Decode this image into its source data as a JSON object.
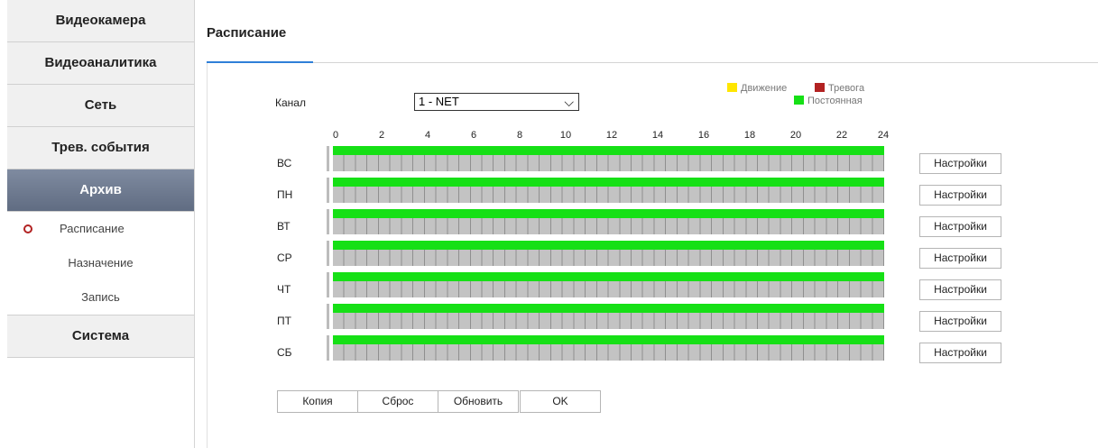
{
  "sidebar": {
    "items_top": [
      {
        "label": "Видеокамера"
      },
      {
        "label": "Видеоаналитика"
      },
      {
        "label": "Сеть"
      },
      {
        "label": "Трев. события"
      },
      {
        "label": "Архив"
      }
    ],
    "subitems": [
      {
        "label": "Расписание"
      },
      {
        "label": "Назначение"
      },
      {
        "label": "Запись"
      }
    ],
    "items_bottom": [
      {
        "label": "Система"
      }
    ]
  },
  "page": {
    "title": "Расписание"
  },
  "channel": {
    "label": "Канал",
    "value": "1 - NET"
  },
  "legend": {
    "motion": {
      "label": "Движение",
      "color": "#ffe600"
    },
    "alarm": {
      "label": "Тревога",
      "color": "#b22222"
    },
    "continuous": {
      "label": "Постоянная",
      "color": "#16e016"
    }
  },
  "hours": [
    "0",
    "2",
    "4",
    "6",
    "8",
    "10",
    "12",
    "14",
    "16",
    "18",
    "20",
    "22",
    "24"
  ],
  "days": [
    {
      "label": "ВС",
      "settings": "Настройки",
      "schedule": "Постоянная 0–24"
    },
    {
      "label": "ПН",
      "settings": "Настройки",
      "schedule": "Постоянная 0–24"
    },
    {
      "label": "ВТ",
      "settings": "Настройки",
      "schedule": "Постоянная 0–24"
    },
    {
      "label": "СР",
      "settings": "Настройки",
      "schedule": "Постоянная 0–24"
    },
    {
      "label": "ЧТ",
      "settings": "Настройки",
      "schedule": "Постоянная 0–24"
    },
    {
      "label": "ПТ",
      "settings": "Настройки",
      "schedule": "Постоянная 0–24"
    },
    {
      "label": "СБ",
      "settings": "Настройки",
      "schedule": "Постоянная 0–24"
    }
  ],
  "buttons": {
    "copy": "Копия",
    "reset": "Сброс",
    "refresh": "Обновить",
    "ok": "OK"
  }
}
